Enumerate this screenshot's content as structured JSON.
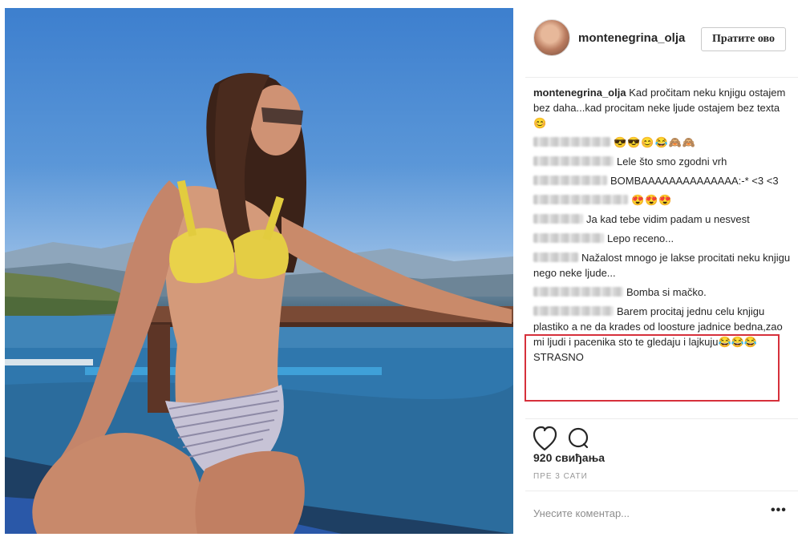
{
  "post": {
    "username": "montenegrina_olja",
    "follow_label": "Пратите ово",
    "caption_user": "montenegrina_olja",
    "caption_text": "Kad pročitam neku knjigu ostajem bez daha...kad procitam neke ljude ostajem bez texta😊",
    "comments": [
      {
        "text": "😎😎😊😂🙈🙈"
      },
      {
        "text": "Lele što smo zgodni vrh"
      },
      {
        "text": "BOMBAAAAAAAAAAAAAA:-* <3 <3"
      },
      {
        "text": "😍😍😍"
      },
      {
        "text": "Ja kad tebe vidim padam u nesvest"
      },
      {
        "text": "Lepo receno..."
      },
      {
        "text": "Nažalost mnogo je lakse procitati neku knjigu nego neke ljude..."
      },
      {
        "text": "Bomba si mačko."
      },
      {
        "text": "Barem procitaj jednu celu knjigu plastiko a ne da krades od loosture jadnice bedna,zao mi ljudi i pacenika sto te gledaju i lajkuju😂😂😂STRASNO"
      }
    ],
    "likes": "920 свиђања",
    "time_ago": "ПРЕ 3 САТИ",
    "comment_placeholder": "Унесите коментар...",
    "more_label": "•••",
    "highlight_color": "#d6303b"
  },
  "icons": [
    "heart-icon",
    "comment-icon",
    "more-options-icon"
  ]
}
